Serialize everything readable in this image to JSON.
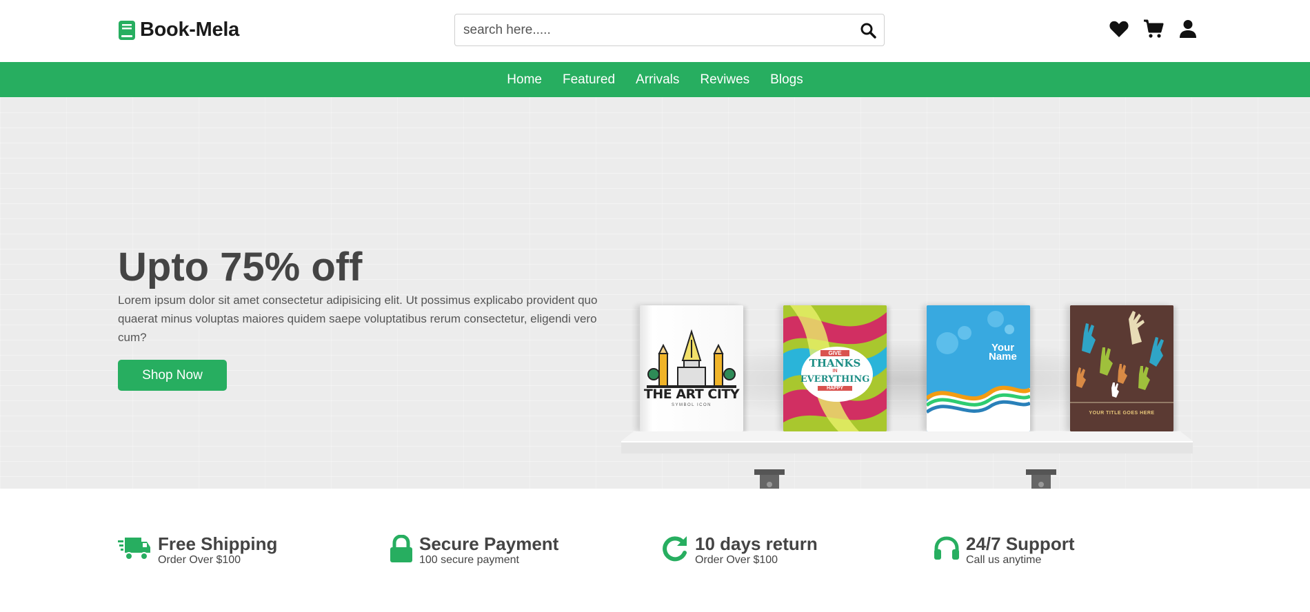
{
  "header": {
    "logo_text": "Book-Mela",
    "search_placeholder": "search here.....",
    "icons": [
      "heart-icon",
      "cart-icon",
      "user-icon"
    ]
  },
  "nav": {
    "items": [
      "Home",
      "Featured",
      "Arrivals",
      "Reviwes",
      "Blogs"
    ]
  },
  "hero": {
    "title": "Upto 75% off",
    "text": "Lorem ipsum dolor sit amet consectetur adipisicing elit. Ut possimus explicabo provident quo quaerat minus voluptas maiores quidem saepe voluptatibus rerum consectetur, eligendi vero cum?",
    "button_label": "Shop Now",
    "books": [
      {
        "title": "THE ART CITY",
        "subtitle": "SYMBOL ICON"
      },
      {
        "line1": "GIVE",
        "line2": "THANKS",
        "line3": "IN",
        "line4": "EVERYTHING",
        "line5": "HAPPY"
      },
      {
        "line1": "Your",
        "line2": "Name"
      },
      {
        "line1": "YOUR TITLE GOES HERE"
      }
    ]
  },
  "features": [
    {
      "icon": "truck-icon",
      "title": "Free Shipping",
      "subtitle": "Order Over $100"
    },
    {
      "icon": "lock-icon",
      "title": "Secure Payment",
      "subtitle": "100 secure payment"
    },
    {
      "icon": "redo-icon",
      "title": "10 days return",
      "subtitle": "Order Over $100"
    },
    {
      "icon": "headset-icon",
      "title": "24/7 Support",
      "subtitle": "Call us anytime"
    }
  ],
  "colors": {
    "accent": "#27ae60",
    "text_dark": "#444444",
    "hero_bg": "#ececec"
  }
}
